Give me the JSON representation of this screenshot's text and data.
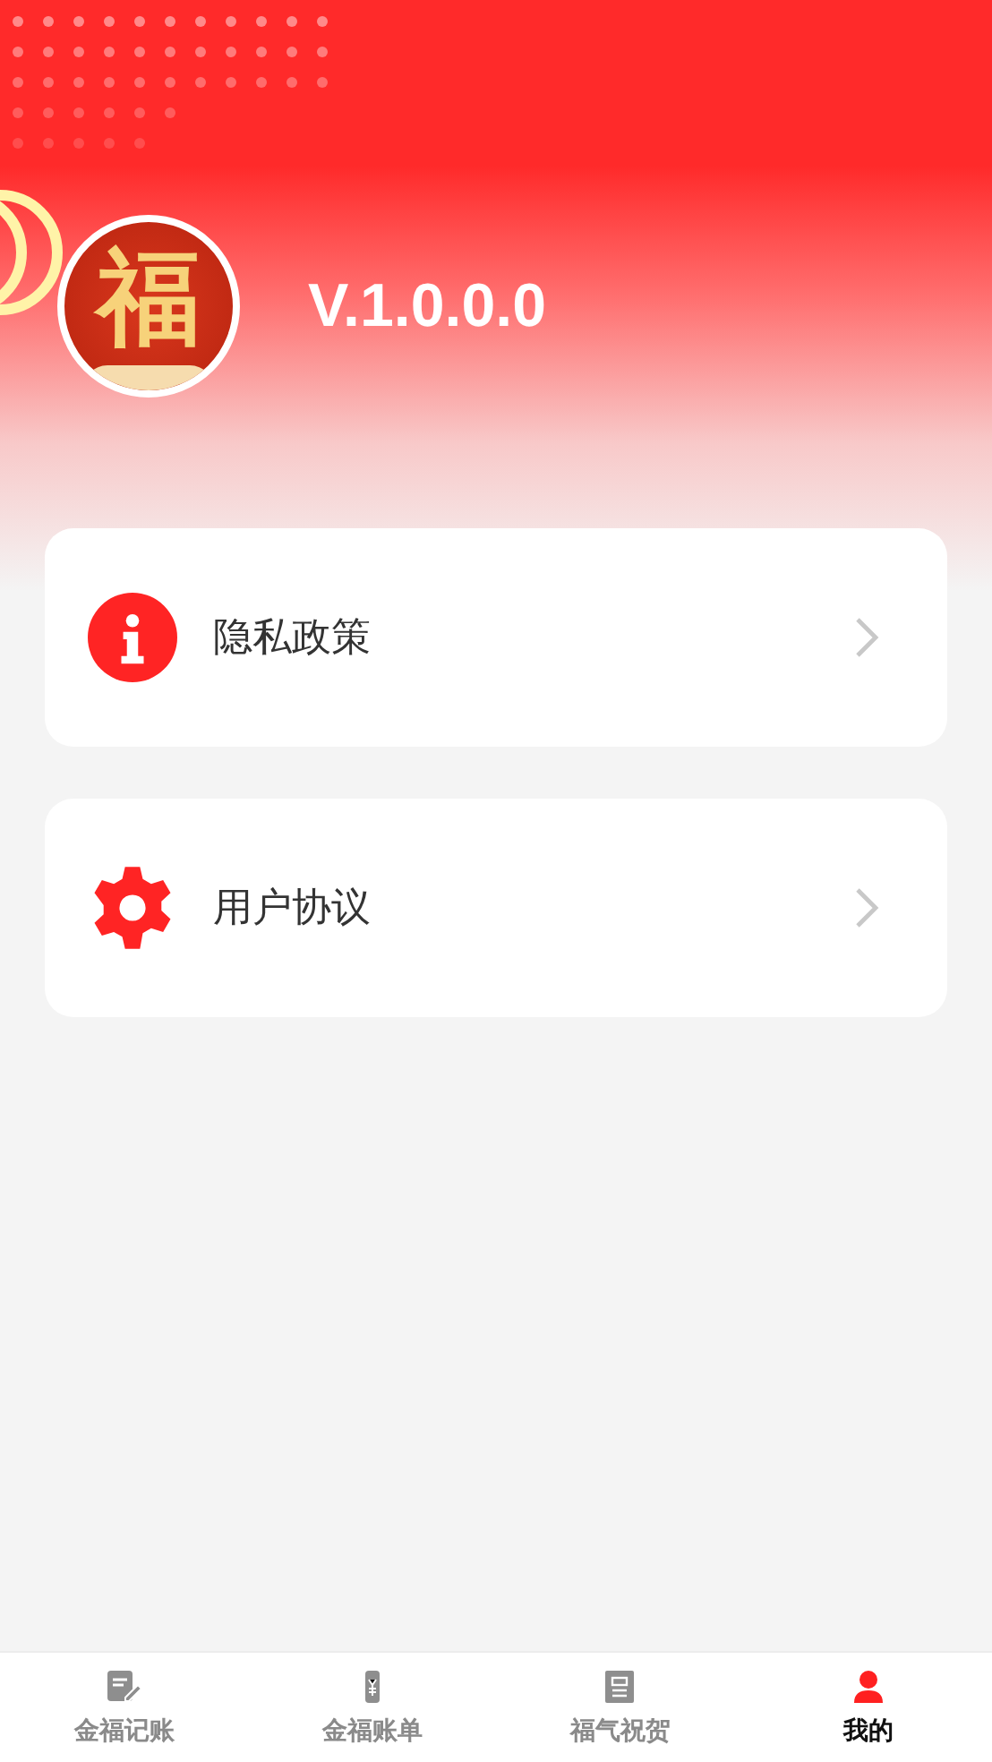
{
  "header": {
    "logo": {
      "character": "福"
    },
    "version": "V.1.0.0.0"
  },
  "menu": [
    {
      "kind": "info",
      "label": "隐私政策"
    },
    {
      "kind": "settings",
      "label": "用户协议"
    }
  ],
  "tab_bar": [
    {
      "kind": "ledger",
      "label": "金福记账",
      "selected": false
    },
    {
      "kind": "bill",
      "label": "金福账单",
      "selected": false
    },
    {
      "kind": "greeting",
      "label": "福气祝贺",
      "selected": false
    },
    {
      "kind": "profile",
      "label": "我的",
      "selected": true
    }
  ]
}
